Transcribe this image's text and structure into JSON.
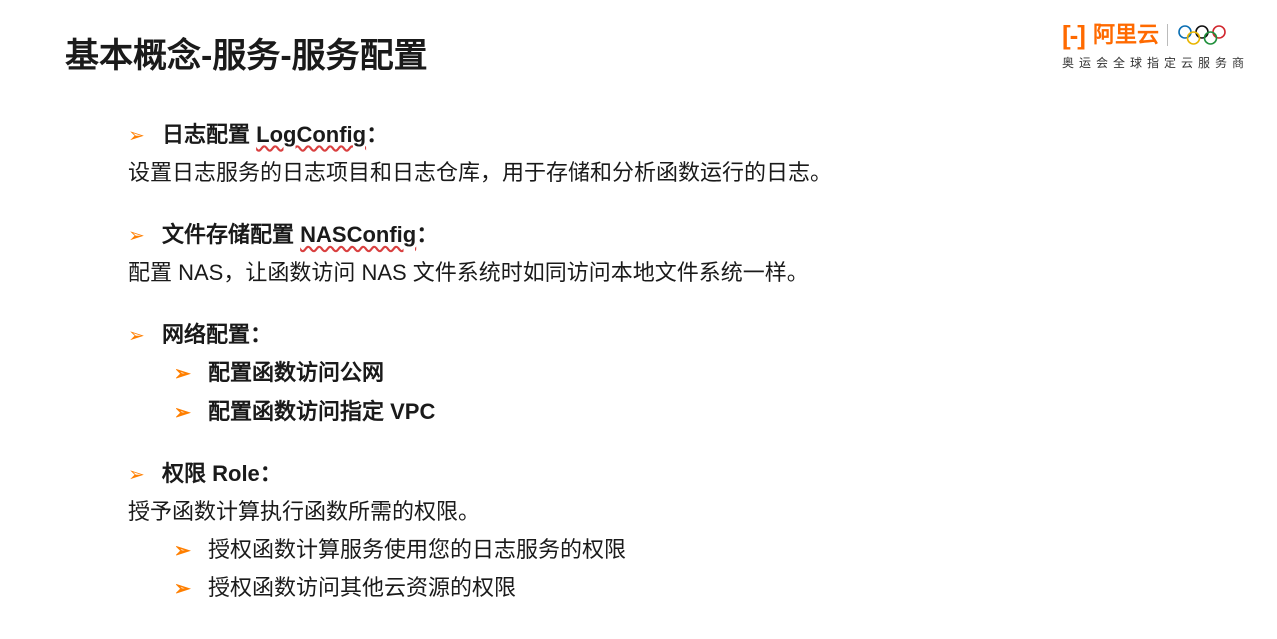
{
  "title": "基本概念-服务-服务配置",
  "logo": {
    "brand_text": "阿里云",
    "tagline": "奥运会全球指定云服务商"
  },
  "sections": [
    {
      "head_prefix": "日志配置 ",
      "head_emph": "LogConfig",
      "head_suffix": "：",
      "desc": "设置日志服务的日志项目和日志仓库，用于存储和分析函数运行的日志。"
    },
    {
      "head_prefix": "文件存储配置 ",
      "head_emph": "NASConfig",
      "head_suffix": "：",
      "desc": "配置 NAS，让函数访问 NAS 文件系统时如同访问本地文件系统一样。"
    },
    {
      "head_prefix": "网络配置",
      "head_emph": "",
      "head_suffix": "：",
      "subs": [
        "配置函数访问公网",
        "配置函数访问指定 VPC"
      ]
    },
    {
      "head_prefix": "权限 Role",
      "head_emph": "",
      "head_suffix": "：",
      "desc": "授予函数计算执行函数所需的权限。",
      "subs": [
        "授权函数计算服务使用您的日志服务的权限",
        "授权函数访问其他云资源的权限"
      ]
    }
  ]
}
